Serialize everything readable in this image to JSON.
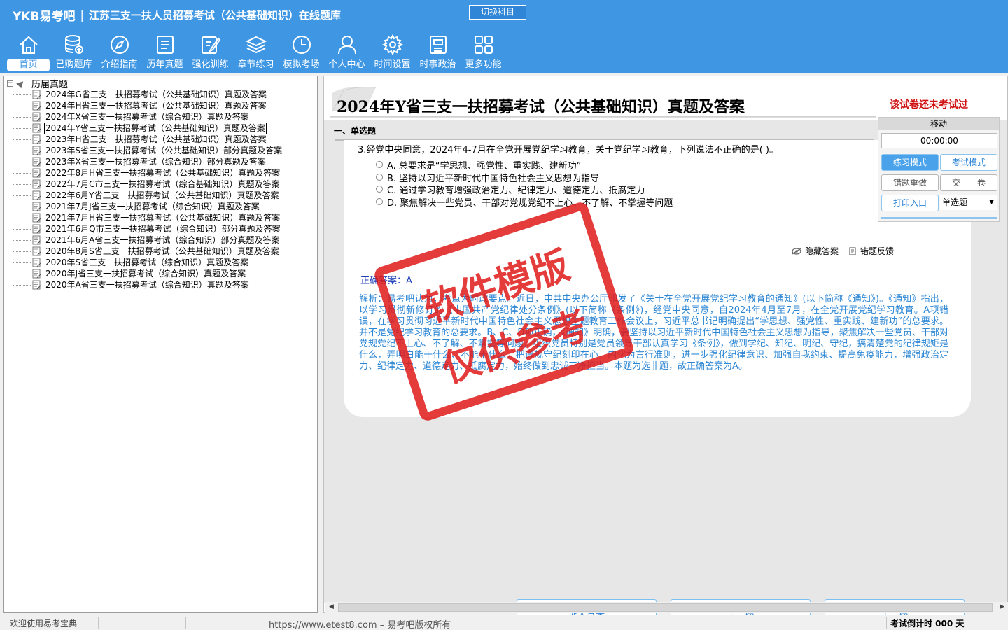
{
  "app": {
    "logo": "YKB易考吧",
    "title": "江苏三支一扶人员招募考试（公共基础知识）在线题库",
    "switch_subject": "切换科目",
    "accent": "#3f97e4"
  },
  "toolbar": [
    {
      "label": "首页",
      "icon": "home-icon"
    },
    {
      "label": "已购题库",
      "icon": "database-icon"
    },
    {
      "label": "介绍指南",
      "icon": "compass-icon"
    },
    {
      "label": "历年真题",
      "icon": "list-doc-icon"
    },
    {
      "label": "强化训练",
      "icon": "edit-icon"
    },
    {
      "label": "章节练习",
      "icon": "layers-icon"
    },
    {
      "label": "模拟考场",
      "icon": "clock-icon"
    },
    {
      "label": "个人中心",
      "icon": "user-icon"
    },
    {
      "label": "时间设置",
      "icon": "gear-icon"
    },
    {
      "label": "时事政治",
      "icon": "news-icon"
    },
    {
      "label": "更多功能",
      "icon": "grid-icon"
    }
  ],
  "tree": {
    "root": "历届真题",
    "items": [
      "2024年G省三支一扶招募考试（公共基础知识）真题及答案",
      "2024年H省三支一扶招募考试（公共基础知识）真题及答案",
      "2024年X省三支一扶招募考试（综合知识）真题及答案",
      "2024年Y省三支一扶招募考试（公共基础知识）真题及答案",
      "2023年H省三支一扶招募考试（公共基础知识）真题及答案",
      "2023年S省三支一扶招募考试（公共基础知识）部分真题及答案",
      "2023年X省三支一扶招募考试（综合知识）部分真题及答案",
      "2022年8月H省三支一扶招募考试（公共基础知识）真题及答案",
      "2022年7月C市三支一扶招募考试（综合基础知识）真题及答案",
      "2022年6月Y省三支一扶招募考试（公共基础知识）真题及答案",
      "2021年7月J省三支一扶招募考试（综合知识）真题及答案",
      "2021年7月H省三支一扶招募考试（公共基础知识）真题及答案",
      "2021年6月Q市三支一扶招募考试（综合知识）部分真题及答案",
      "2021年6月A省三支一扶招募考试（综合知识）部分真题及答案",
      "2020年8月S省三支一扶招募考试（公共基础知识）真题及答案",
      "2020年S省三支一扶招募考试（综合知识）真题及答案",
      "2020年J省三支一扶招募考试（综合知识）真题及答案",
      "2020年A省三支一扶招募考试（综合知识）真题及答案"
    ],
    "selected_index": 3
  },
  "paper": {
    "title": "2024年Y省三支一扶招募考试（公共基础知识）真题及答案",
    "status": "该试卷还未考试过"
  },
  "question": {
    "section": "一、单选题",
    "text": "3.经党中央同意，2024年4-7月在全党开展党纪学习教育，关于党纪学习教育，下列说法不正确的是( )。",
    "options": [
      "A. 总要求是“学思想、强党性、重实践、建新功”",
      "B. 坚持以习近平新时代中国特色社会主义思想为指导",
      "C. 通过学习教育增强政治定力、纪律定力、道德定力、抵腐定力",
      "D. 聚焦解决一些党员、干部对党规党纪不上心、不了解、不掌握等问题"
    ],
    "hide_answer": "隐藏答案",
    "feedback": "错题反馈",
    "correct_answer": "正确答案：A",
    "analysis": "解析：易考吧认为，考点为时政要点。近日，中共中央办公厅印发了《关于在全党开展党纪学习教育的通知》(以下简称《通知》)。《通知》指出，以学习贯彻新修订的《中国共产党纪律处分条例》(以下简称《条例》)，经党中央同意，自2024年4月至7月，在全党开展党纪学习教育。A项错误，在学习贯彻习近平新时代中国特色社会主义思想主题教育工作会议上，习近平总书记明确提出“学思想、强党性、重实践、建新功”的总要求。并不是党纪学习教育的总要求。B、C、D项正确，《通知》明确，要坚持以习近平新时代中国特色社会主义思想为指导，聚焦解决一些党员、干部对党规党纪不上心、不了解、不掌握等问题，组织党员特别是党员领导干部认真学习《条例》，做到学纪、知纪、明纪、守纪，搞清楚党的纪律规矩是什么，弄明白能干什么、不能干什么，把遵规守纪刻印在心，内化为言行准则，进一步强化纪律意识、加强自我约束、提高免疫能力，增强政治定力、纪律定力、道德定力、抵腐定力，始终做到忠诚干净担当。本题为选非题，故正确答案为A。"
  },
  "stamp": {
    "line1": "软件模版",
    "line2": "仅供参考",
    "color": "#e0191a"
  },
  "nav": {
    "submit": "提交答案",
    "prev": "上一题",
    "next": "下一题"
  },
  "ctrl": {
    "move": "移动",
    "timer": "00:00:00",
    "practice_mode": "练习模式",
    "exam_mode": "考试模式",
    "redo_wrong": "错题重做",
    "submit_paper": "交　　卷",
    "print": "打印入口",
    "qtype": "单选题"
  },
  "statusbar": {
    "welcome": "欢迎使用易考宝典",
    "copyright": "https://www.etest8.com – 易考吧版权所有",
    "countdown": "考试倒计时 000 天"
  }
}
